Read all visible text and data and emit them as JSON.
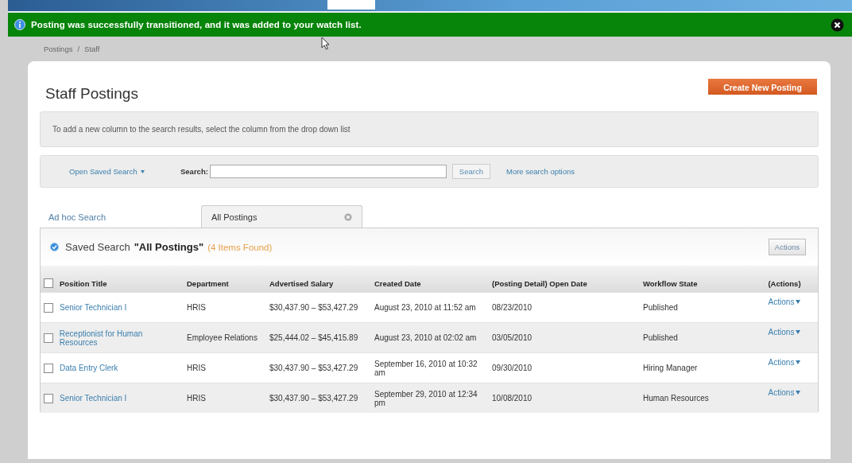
{
  "notification": {
    "message": "Posting was successfully transitioned, and it was added to your watch list."
  },
  "breadcrumb": {
    "items": [
      "Postings",
      "Staff"
    ],
    "separator": "/"
  },
  "page_title": "Staff Postings",
  "create_button": "Create New Posting",
  "info_message": "To add a new column to the search results, select the column from the drop down list",
  "search": {
    "saved_search_link": "Open Saved Search",
    "label": "Search:",
    "button": "Search",
    "more_link": "More search options"
  },
  "tabs": [
    {
      "label": "Ad hoc Search",
      "selected": false,
      "closable": false
    },
    {
      "label": "All Postings",
      "selected": true,
      "closable": true
    }
  ],
  "results": {
    "prefix": "Saved Search",
    "name": "\"All Postings\"",
    "count": "(4 Items Found)",
    "actions_button": "Actions"
  },
  "table": {
    "select_all_checked": false,
    "columns": [
      "Position Title",
      "Department",
      "Advertised Salary",
      "Created Date",
      "(Posting Detail) Open Date",
      "Workflow State",
      "(Actions)"
    ],
    "rows": [
      {
        "checked": false,
        "title": "Senior Technician I",
        "department": "HRIS",
        "salary": "$30,437.90 – $53,427.29",
        "created": "August 23, 2010 at 11:52 am",
        "open_date": "08/23/2010",
        "state": "Published",
        "action": "Actions"
      },
      {
        "checked": false,
        "title": "Receptionist for Human Resources",
        "department": "Employee Relations",
        "salary": "$25,444.02 – $45,415.89",
        "created": "August 23, 2010 at 02:02 am",
        "open_date": "03/05/2010",
        "state": "Published",
        "action": "Actions"
      },
      {
        "checked": false,
        "title": "Data Entry Clerk",
        "department": "HRIS",
        "salary": "$30,437.90 – $53,427.29",
        "created": "September 16, 2010 at 10:32 am",
        "open_date": "09/30/2010",
        "state": "Hiring Manager",
        "action": "Actions"
      },
      {
        "checked": false,
        "title": "Senior Technician I",
        "department": "HRIS",
        "salary": "$30,437.90 – $53,427.29",
        "created": "September 29, 2010 at 12:34 pm",
        "open_date": "10/08/2010",
        "state": "Human Resources",
        "action": "Actions"
      }
    ]
  }
}
